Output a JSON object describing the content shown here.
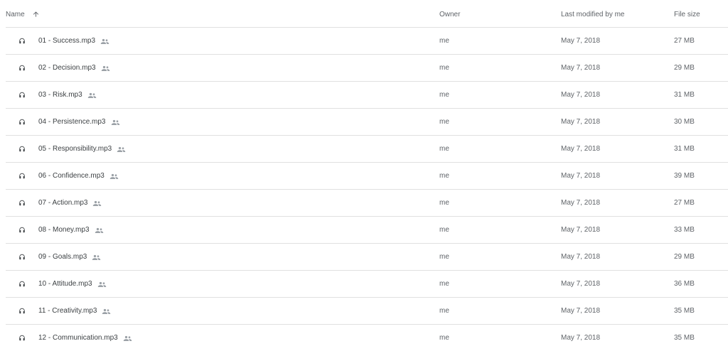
{
  "columns": {
    "name": "Name",
    "owner": "Owner",
    "modified": "Last modified by me",
    "size": "File size"
  },
  "icons": {
    "sort": "arrow-upward-icon",
    "file": "headphones-icon",
    "shared": "shared-people-icon"
  },
  "files": [
    {
      "name": "01 - Success.mp3",
      "owner": "me",
      "modified": "May 7, 2018",
      "size": "27 MB"
    },
    {
      "name": "02 - Decision.mp3",
      "owner": "me",
      "modified": "May 7, 2018",
      "size": "29 MB"
    },
    {
      "name": "03 - Risk.mp3",
      "owner": "me",
      "modified": "May 7, 2018",
      "size": "31 MB"
    },
    {
      "name": "04 - Persistence.mp3",
      "owner": "me",
      "modified": "May 7, 2018",
      "size": "30 MB"
    },
    {
      "name": "05 - Responsibility.mp3",
      "owner": "me",
      "modified": "May 7, 2018",
      "size": "31 MB"
    },
    {
      "name": "06 - Confidence.mp3",
      "owner": "me",
      "modified": "May 7, 2018",
      "size": "39 MB"
    },
    {
      "name": "07 - Action.mp3",
      "owner": "me",
      "modified": "May 7, 2018",
      "size": "27 MB"
    },
    {
      "name": "08 - Money.mp3",
      "owner": "me",
      "modified": "May 7, 2018",
      "size": "33 MB"
    },
    {
      "name": "09 - Goals.mp3",
      "owner": "me",
      "modified": "May 7, 2018",
      "size": "29 MB"
    },
    {
      "name": "10 - Attitude.mp3",
      "owner": "me",
      "modified": "May 7, 2018",
      "size": "36 MB"
    },
    {
      "name": "11 - Creativity.mp3",
      "owner": "me",
      "modified": "May 7, 2018",
      "size": "35 MB"
    },
    {
      "name": "12 - Communication.mp3",
      "owner": "me",
      "modified": "May 7, 2018",
      "size": "35 MB"
    }
  ]
}
